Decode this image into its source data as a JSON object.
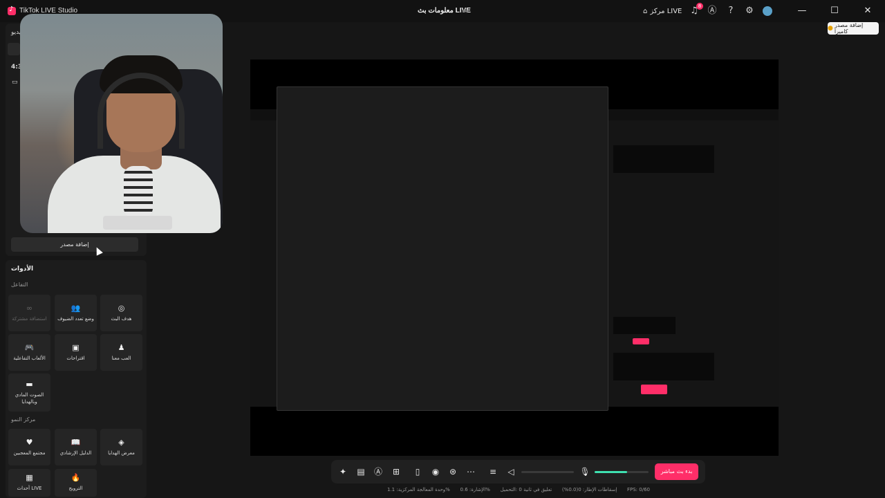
{
  "titlebar": {
    "app_title": "TikTok LIVE Studio",
    "center_title": "معلومات بث LIVE",
    "live_center_label": "مركز LIVE",
    "notification_count": "8",
    "icons": [
      "home-icon",
      "bell-icon",
      "ai-icon",
      "help-icon",
      "settings-icon",
      "avatar",
      "minimize-icon",
      "maximize-icon",
      "close-icon"
    ]
  },
  "tooltip": {
    "text": "إضافة مصدر كاميرا",
    "icon": "bulb-icon"
  },
  "sources": {
    "header_fragment": "يديو",
    "ratio_fragment": "4:3",
    "add_source_label": "إضافة مصدر"
  },
  "tools": {
    "title": "الأدوات",
    "section_interaction": "التفاعل",
    "section_creator": "مركز النمو",
    "items": [
      {
        "label": "هدف البث",
        "icon": "target-icon",
        "enabled": true
      },
      {
        "label": "وضع تعدد الضيوف",
        "icon": "guests-icon",
        "enabled": true
      },
      {
        "label": "استضافة مشتركة",
        "icon": "link-icon",
        "enabled": false
      },
      {
        "label": "العب معنا",
        "icon": "play-with-icon",
        "enabled": true
      },
      {
        "label": "اقتراحات",
        "icon": "gift-box-icon",
        "enabled": true
      },
      {
        "label": "الألعاب التفاعلية",
        "icon": "gamepad-icon",
        "enabled": true
      },
      {
        "label": "الصوت المادي وبالهدايا",
        "icon": "sound-icon",
        "enabled": true
      },
      {
        "label": "مجتمع المعجبين",
        "icon": "heart-icon",
        "enabled": true
      },
      {
        "label": "الدليل الإرشادي",
        "icon": "book-icon",
        "enabled": true
      },
      {
        "label": "معرض الهدايا",
        "icon": "gallery-icon",
        "enabled": true
      },
      {
        "label": "أحداث LIVE",
        "icon": "calendar-icon",
        "enabled": true
      },
      {
        "label": "الترويج",
        "icon": "fire-icon",
        "enabled": true
      }
    ]
  },
  "controls": {
    "go_live_label": "بدء بث مباشر",
    "mic_level": 0.6,
    "volume_level": 0.0,
    "icons": [
      "magic-icon",
      "comment-icon",
      "ai-icon",
      "add-scene-icon",
      "phone-icon",
      "record-icon",
      "camera-switch-icon",
      "more-icon",
      "mixer-icon",
      "speaker-icon",
      "mic-icon"
    ]
  },
  "status": {
    "items": [
      "FPS: 0/60",
      "إسقاطات الإطار: 0(0.0%)",
      "تعليق في ثانية 0 :التحميل",
      "الإشارة: 0.6%",
      "وحدة المعالجة المركزية: 1.1%"
    ]
  },
  "colors": {
    "accent": "#ff2e68",
    "meter": "#3fe0b0",
    "bg": "#161616"
  }
}
